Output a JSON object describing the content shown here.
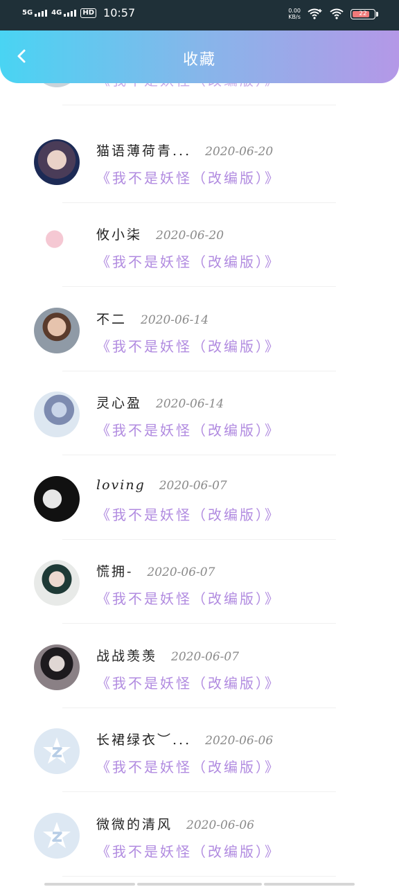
{
  "status": {
    "sig1": "5G",
    "sig2": "4G",
    "hd": "HD",
    "time": "10:57",
    "speed_val": "0.00",
    "speed_unit": "KB/s",
    "battery": "22"
  },
  "header": {
    "title": "收藏"
  },
  "items": [
    {
      "name": "猫语薄荷青...",
      "date": "2020-06-20",
      "song": "《我不是妖怪（改编版）》",
      "avatar": "photo"
    },
    {
      "name": "攸小柒",
      "date": "2020-06-20",
      "song": "《我不是妖怪（改编版）》",
      "avatar": "sketch"
    },
    {
      "name": "不二",
      "date": "2020-06-14",
      "song": "《我不是妖怪（改编版）》",
      "avatar": "boy"
    },
    {
      "name": "灵心盈",
      "date": "2020-06-14",
      "song": "《我不是妖怪（改编版）》",
      "avatar": "anime"
    },
    {
      "name": "loving",
      "date": "2020-06-07",
      "song": "《我不是妖怪（改编版）》",
      "avatar": "dark"
    },
    {
      "name": "慌拥-",
      "date": "2020-06-07",
      "song": "《我不是妖怪（改编版）》",
      "avatar": "girl"
    },
    {
      "name": "战战羡羡",
      "date": "2020-06-07",
      "song": "《我不是妖怪（改编版）》",
      "avatar": "goth"
    },
    {
      "name": "长裙绿衣︶...",
      "date": "2020-06-06",
      "song": "《我不是妖怪（改编版）》",
      "avatar": "default"
    },
    {
      "name": "微微的清风",
      "date": "2020-06-06",
      "song": "《我不是妖怪（改编版）》",
      "avatar": "default"
    }
  ],
  "partial_top": {
    "song": "《我不是妖怪（改编版）》"
  }
}
